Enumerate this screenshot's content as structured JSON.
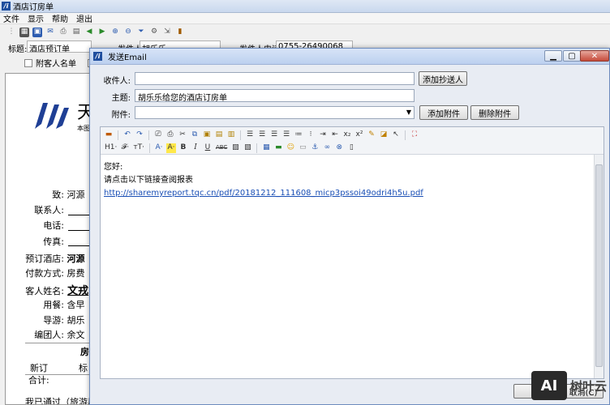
{
  "main": {
    "title": "酒店订房单",
    "menu": [
      "文件",
      "显示",
      "帮助",
      "退出"
    ],
    "title_label": "标题:",
    "title_value": "酒店预订单",
    "sender_label": "发件人:",
    "sender_value": "胡乐乐",
    "sender_phone_label": "发件人电话:",
    "sender_phone_value": "0755-26490068",
    "attach_list_label": "附客人名单"
  },
  "document": {
    "brand": "天",
    "small": "本图",
    "rows": [
      {
        "k": "致:",
        "v": "河源"
      },
      {
        "k": "联系人:",
        "v": ""
      },
      {
        "k": "电话:",
        "v": ""
      },
      {
        "k": "传真:",
        "v": ""
      },
      {
        "k": "预订酒店:",
        "v": "河源"
      },
      {
        "k": "付款方式:",
        "v": "房费"
      },
      {
        "k": "客人姓名:",
        "v": "文戎"
      },
      {
        "k": "用餐:",
        "v": "含早"
      },
      {
        "k": "导游:",
        "v": "胡乐"
      },
      {
        "k": "编团人:",
        "v": "余文"
      }
    ],
    "table_header": "房",
    "table_col1": "新订",
    "table_col2": "标",
    "total_label": "合计:",
    "footer": "我已通过（旅游局"
  },
  "dialog": {
    "title": "发送Email",
    "to_label": "收件人:",
    "to_value": "",
    "cc_button": "添加抄送人",
    "subject_label": "主题:",
    "subject_value": "胡乐乐给您的酒店订房单",
    "attach_label": "附件:",
    "attach_value": "",
    "add_attach_button": "添加附件",
    "del_attach_button": "删除附件",
    "toolbar_row2": {
      "h1": "H1·",
      "font": "𝓕·",
      "size": "тT·",
      "color_a": "A·",
      "bg_a": "A·",
      "bold": "B",
      "italic": "I",
      "underline": "U",
      "abc": "ABC"
    },
    "body_line1": "您好:",
    "body_line2": "请点击以下链接查阅报表",
    "body_link": "http://sharemyreport.tqc.cn/pdf/20181212_111608_micp3pssoi49odri4h5u.pdf",
    "cancel_button": "取消(C)"
  },
  "watermark": {
    "logo": "AI",
    "text": "树叶云"
  }
}
